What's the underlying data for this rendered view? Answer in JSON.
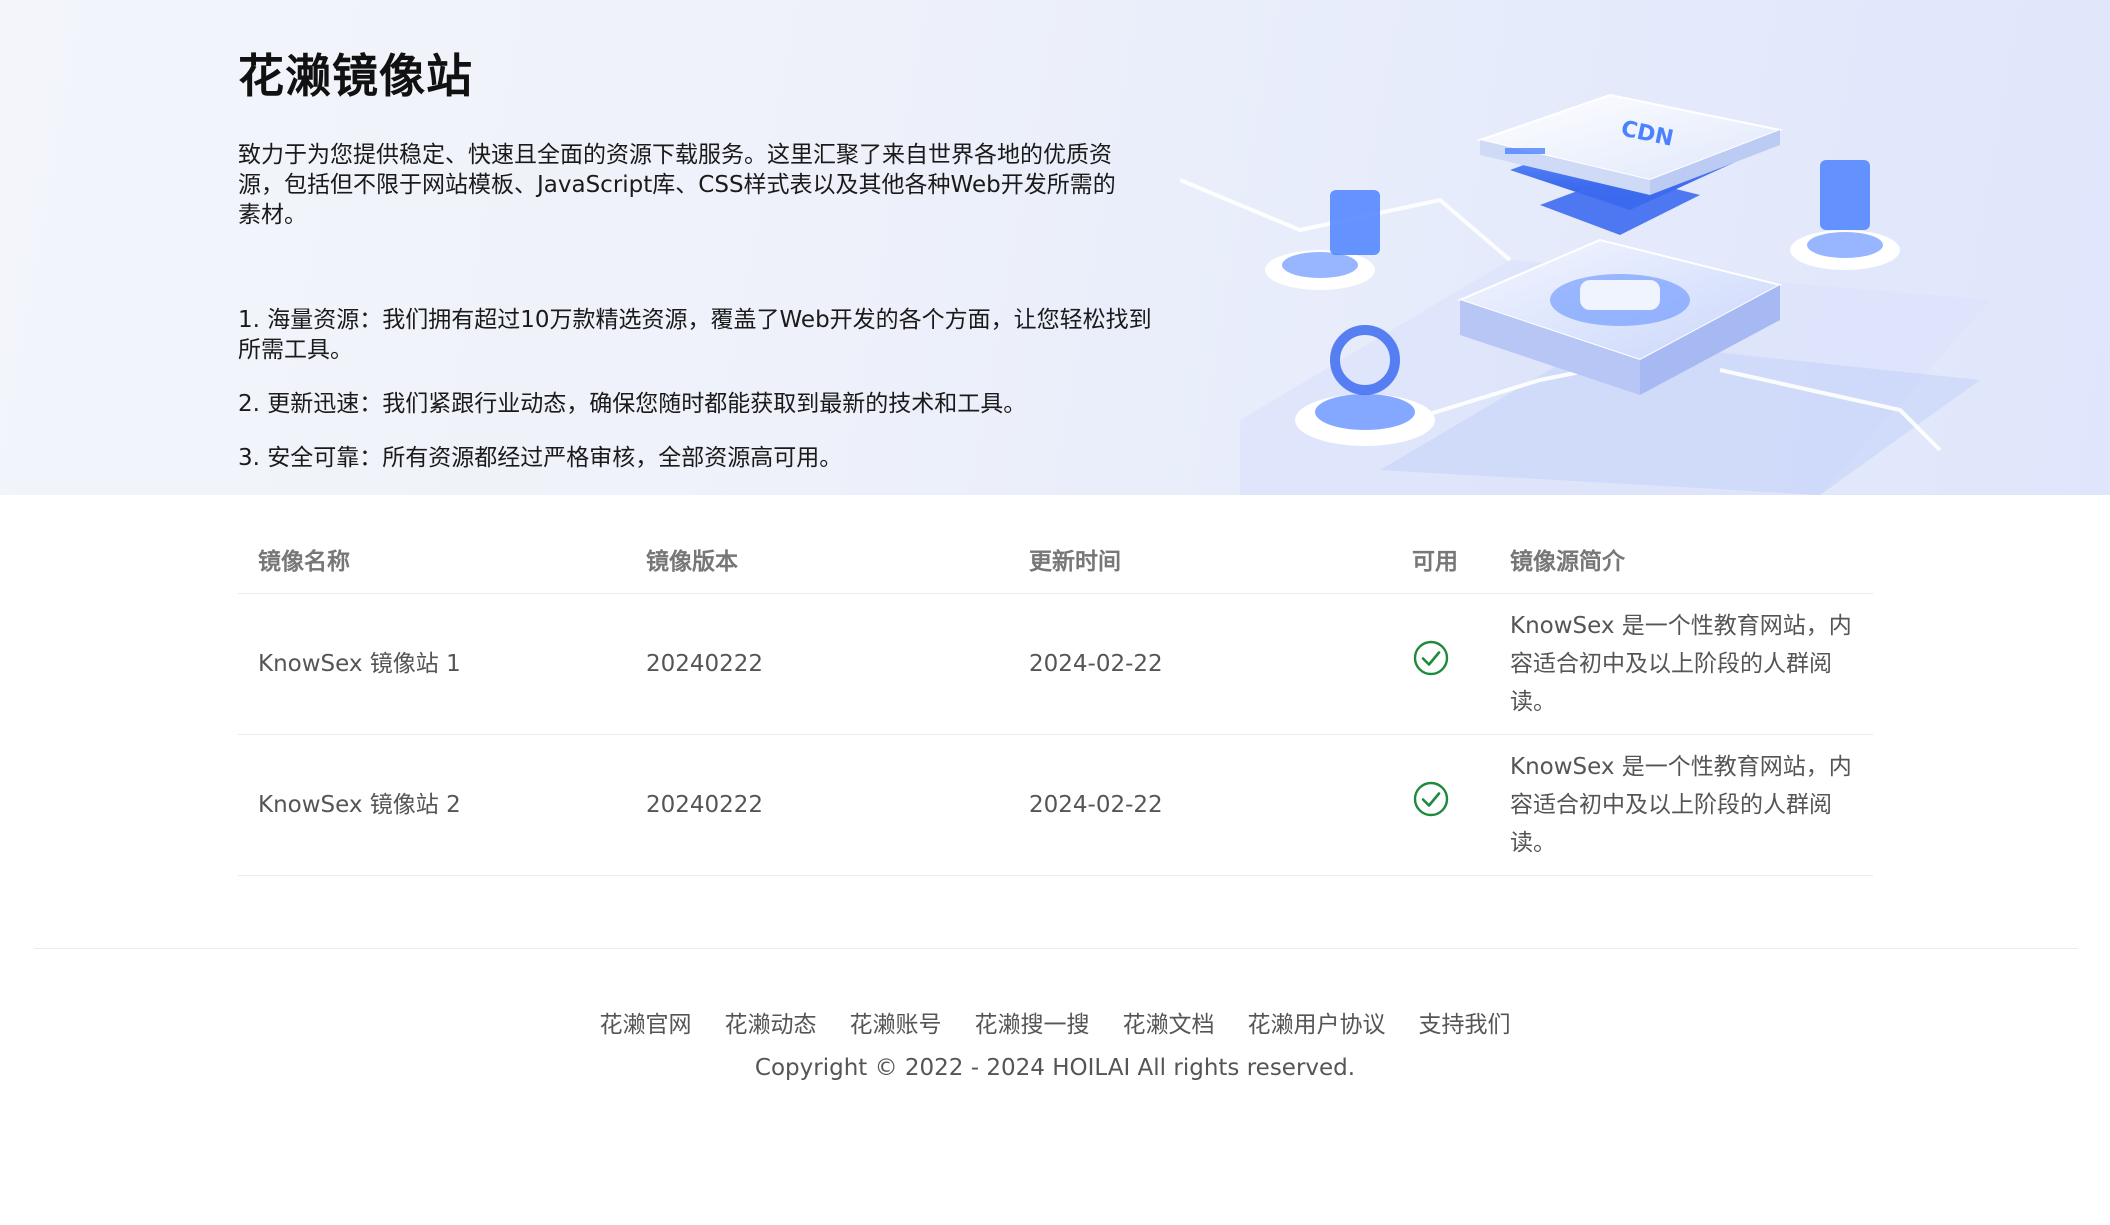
{
  "hero": {
    "title": "花濑镜像站",
    "description": "致力于为您提供稳定、快速且全面的资源下载服务。这里汇聚了来自世界各地的优质资源，包括但不限于网站模板、JavaScript库、CSS样式表以及其他各种Web开发所需的素材。",
    "features": [
      "1. 海量资源：我们拥有超过10万款精选资源，覆盖了Web开发的各个方面，让您轻松找到所需工具。",
      "2. 更新迅速：我们紧跟行业动态，确保您随时都能获取到最新的技术和工具。",
      "3. 安全可靠：所有资源都经过严格审核，全部资源高可用。"
    ],
    "illustration_label": "CDN"
  },
  "table": {
    "headers": [
      "镜像名称",
      "镜像版本",
      "更新时间",
      "可用",
      "镜像源简介"
    ],
    "rows": [
      {
        "name": "KnowSex 镜像站 1",
        "version": "20240222",
        "updated": "2024-02-22",
        "available_icon": "check-circle-icon",
        "description": "KnowSex 是一个性教育网站，内容适合初中及以上阶段的人群阅读。"
      },
      {
        "name": "KnowSex 镜像站 2",
        "version": "20240222",
        "updated": "2024-02-22",
        "available_icon": "check-circle-icon",
        "description": "KnowSex 是一个性教育网站，内容适合初中及以上阶段的人群阅读。"
      }
    ]
  },
  "footer": {
    "links": [
      "花濑官网",
      "花濑动态",
      "花濑账号",
      "花濑搜一搜",
      "花濑文档",
      "花濑用户协议",
      "支持我们"
    ],
    "copyright": "Copyright © 2022 - 2024 HOILAI All rights reserved."
  },
  "colors": {
    "check_green": "#1e8a3c",
    "accent_blue": "#3f7bff"
  }
}
